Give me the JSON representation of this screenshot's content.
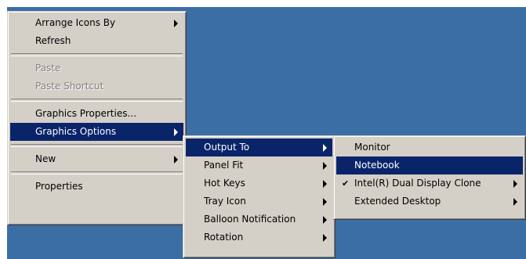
{
  "desktop_color": "#3a6ea5",
  "context_menu": {
    "items": [
      {
        "label": "Arrange Icons By",
        "submenu": true
      },
      {
        "label": "Refresh"
      },
      {
        "label": "Paste",
        "disabled": true
      },
      {
        "label": "Paste Shortcut",
        "disabled": true
      },
      {
        "label": "Graphics Properties..."
      },
      {
        "label": "Graphics Options",
        "submenu": true,
        "highlighted": true
      },
      {
        "label": "New",
        "submenu": true
      },
      {
        "label": "Properties"
      }
    ]
  },
  "graphics_options_menu": {
    "items": [
      {
        "label": "Output To",
        "submenu": true,
        "highlighted": true
      },
      {
        "label": "Panel Fit",
        "submenu": true
      },
      {
        "label": "Hot Keys",
        "submenu": true
      },
      {
        "label": "Tray Icon",
        "submenu": true
      },
      {
        "label": "Balloon Notification",
        "submenu": true
      },
      {
        "label": "Rotation",
        "submenu": true
      }
    ]
  },
  "output_to_menu": {
    "items": [
      {
        "label": "Monitor"
      },
      {
        "label": "Notebook",
        "highlighted": true
      },
      {
        "label": "Intel(R) Dual Display Clone",
        "submenu": true,
        "checked": true
      },
      {
        "label": "Extended Desktop",
        "submenu": true
      }
    ]
  },
  "highlight_color": "#0a246a",
  "menu_color": "#d4d0c8"
}
